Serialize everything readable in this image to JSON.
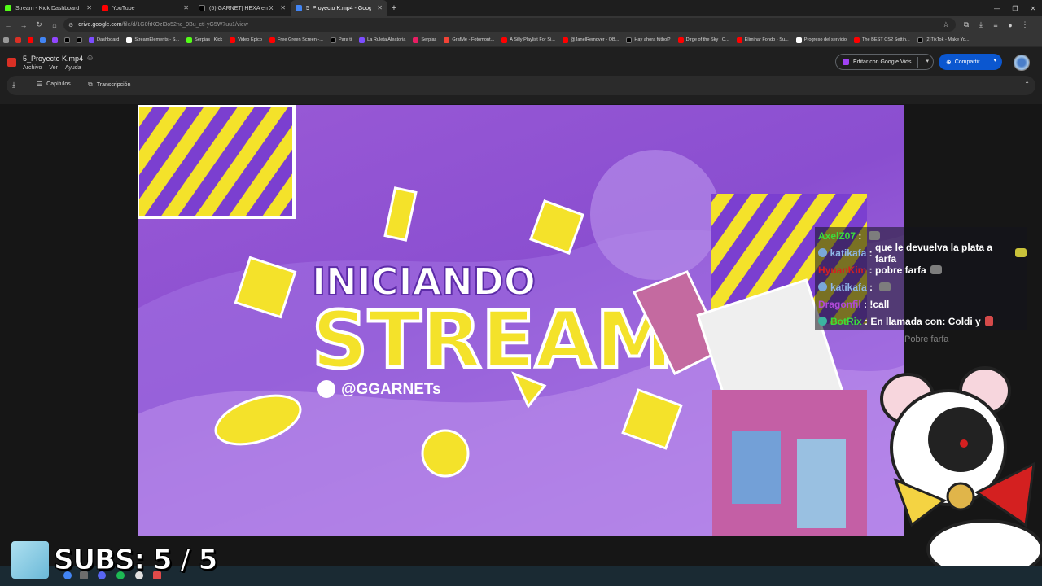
{
  "browser": {
    "tabs": [
      {
        "title": "Stream - Kick Dashboard",
        "color": "#53fc18",
        "active": false
      },
      {
        "title": "YouTube",
        "color": "#ff0000",
        "active": false
      },
      {
        "title": "(5) GARNET| HEXA en X: \"Bien...",
        "color": "#000000",
        "active": false
      },
      {
        "title": "5_Proyecto K.mp4 - Google...",
        "color": "#4285f4",
        "active": true
      }
    ],
    "url_domain": "drive.google.com",
    "url_path": "/file/d/1G8frKOzI3o52nc_9Bu_ctl-yG5W7uu1/view",
    "bookmarks": [
      {
        "label": "Dashboard",
        "color": "#7c4dff"
      },
      {
        "label": "StreamElements - S...",
        "color": "#ffffff"
      },
      {
        "label": "Serpias | Kick",
        "color": "#53fc18"
      },
      {
        "label": "Video Epico",
        "color": "#ff0000"
      },
      {
        "label": "Free Green Screen -...",
        "color": "#ff0000"
      },
      {
        "label": "Para ti",
        "color": "#000000"
      },
      {
        "label": "La Ruleta Aleatoria",
        "color": "#7c4dff"
      },
      {
        "label": "Serpias",
        "color": "#e91e63"
      },
      {
        "label": "GrafMe - Fotomont...",
        "color": "#f44336"
      },
      {
        "label": "A Silly Playlist For Si...",
        "color": "#ff0000"
      },
      {
        "label": "@JanelRemover - OB...",
        "color": "#ff0000"
      },
      {
        "label": "Hay ahora fútbol?",
        "color": "#000000"
      },
      {
        "label": "Dirge of the Sky | C...",
        "color": "#ff0000"
      },
      {
        "label": "Eliminar Fondo - Su...",
        "color": "#ff0000"
      },
      {
        "label": "Progreso del servicio",
        "color": "#ffffff"
      },
      {
        "label": "The BEST CS2 Settin...",
        "color": "#ff0000"
      },
      {
        "label": "(2)TikTok - Make Yo...",
        "color": "#000000"
      }
    ]
  },
  "drive": {
    "file_name": "5_Proyecto K.mp4",
    "menu": [
      "Archivo",
      "Ver",
      "Ayuda"
    ],
    "edit_button": "Editar con Google Vids",
    "share_button": "Compartir",
    "toolbar": {
      "chapters": "Capítulos",
      "transcript": "Transcripción"
    }
  },
  "video": {
    "line1": "INICIANDO",
    "line2": "STREAM",
    "handle": "@GGARNETs"
  },
  "overlay": {
    "chat": [
      {
        "user": "AxelZ07",
        "user_color": "#3cdc3c",
        "message": "",
        "emote": true,
        "badge": false
      },
      {
        "user": "katikafa",
        "user_color": "#8fb7e8",
        "message": "que le devuelva la plata a farfa",
        "emote": true,
        "badge": true
      },
      {
        "user": "HyuanKim",
        "user_color": "#d42020",
        "message": "pobre farfa",
        "emote": true,
        "badge": false
      },
      {
        "user": "katikafa",
        "user_color": "#8fb7e8",
        "message": "",
        "emote": true,
        "badge": true
      },
      {
        "user": "Dragonfil",
        "user_color": "#b04ad8",
        "message": "!call",
        "emote": false,
        "badge": false
      },
      {
        "user": "BotRix",
        "user_color": "#3cdc3c",
        "message": "En llamada con: Coldi y",
        "emote": true,
        "badge": true
      }
    ],
    "faded_line": "Pobre farfa",
    "subs": "SUBS: 5 / 5"
  }
}
